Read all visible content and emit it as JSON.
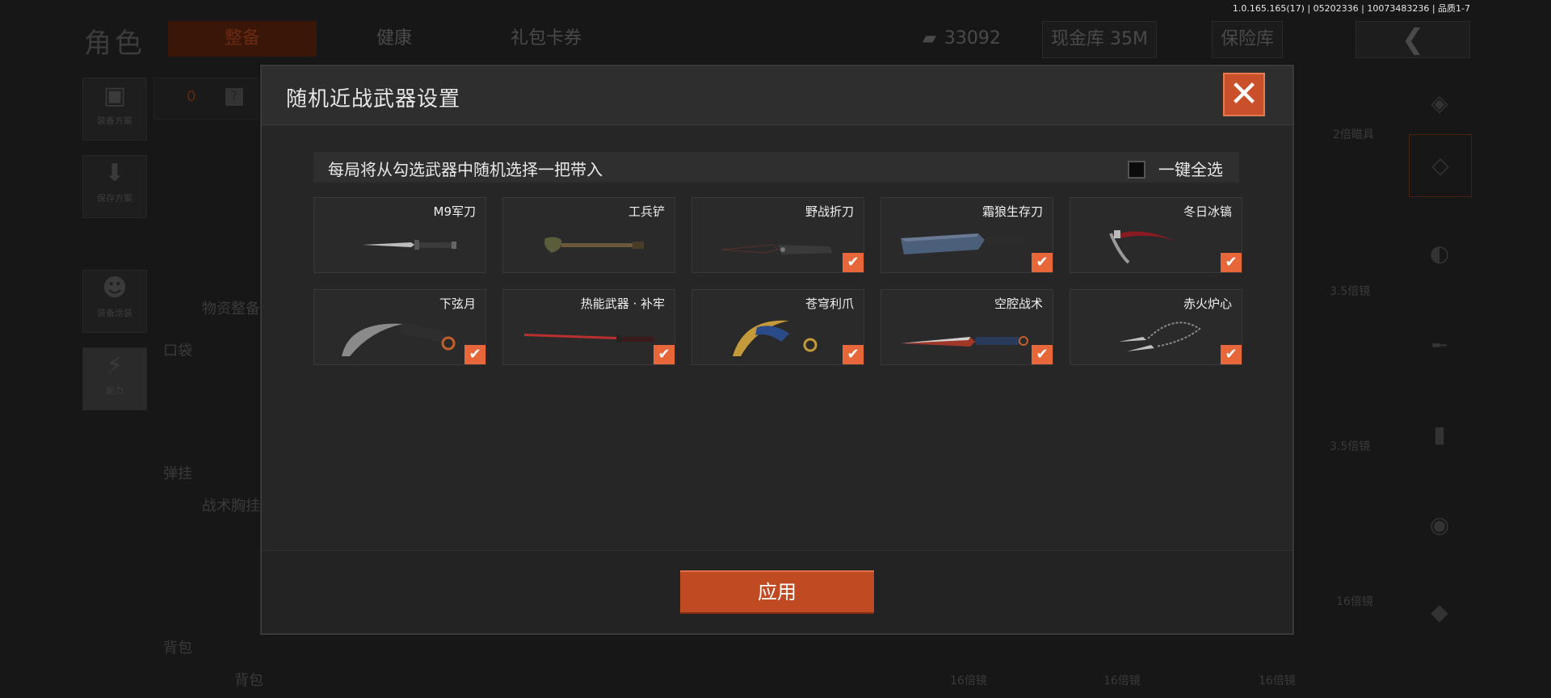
{
  "version_text": "1.0.165.165(17) | 05202336 | 10073483236 | 品质1-7",
  "background": {
    "title": "角色",
    "tabs": [
      "整备",
      "健康",
      "礼包卡券"
    ],
    "currency": "33092",
    "cash_vault": "现金库 35M",
    "safe_box": "保险库",
    "side_buttons": [
      "装备方案",
      "保存方案",
      "装备涂装",
      "能力"
    ],
    "armor_count": "0",
    "material_label": "物资整备",
    "sections": [
      "口袋",
      "弹挂",
      "战术胸挂",
      "背包",
      "背包"
    ],
    "scopes": [
      "2倍瞄具",
      "3.5倍镜",
      "3.5倍镜",
      "16倍镜",
      "16倍镜",
      "16倍镜",
      "16倍镜"
    ]
  },
  "modal": {
    "title": "随机近战武器设置",
    "info": "每局将从勾选武器中随机选择一把带入",
    "select_all": "一键全选",
    "apply": "应用",
    "weapons": [
      {
        "name": "M9军刀",
        "checked": false,
        "icon": "knife-icon"
      },
      {
        "name": "工兵铲",
        "checked": false,
        "icon": "shovel-icon"
      },
      {
        "name": "野战折刀",
        "checked": true,
        "icon": "folding-knife-icon"
      },
      {
        "name": "霜狼生存刀",
        "checked": true,
        "icon": "machete-icon"
      },
      {
        "name": "冬日冰镐",
        "checked": true,
        "icon": "ice-pick-icon"
      },
      {
        "name": "下弦月",
        "checked": true,
        "icon": "karambit-icon"
      },
      {
        "name": "热能武器 · 补牢",
        "checked": true,
        "icon": "katana-icon"
      },
      {
        "name": "苍穹利爪",
        "checked": true,
        "icon": "claw-icon"
      },
      {
        "name": "空腔战术",
        "checked": true,
        "icon": "tactical-knife-icon"
      },
      {
        "name": "赤火炉心",
        "checked": true,
        "icon": "chain-dagger-icon"
      }
    ]
  },
  "colors": {
    "accent": "#e8673a",
    "apply": "#c04a22"
  }
}
